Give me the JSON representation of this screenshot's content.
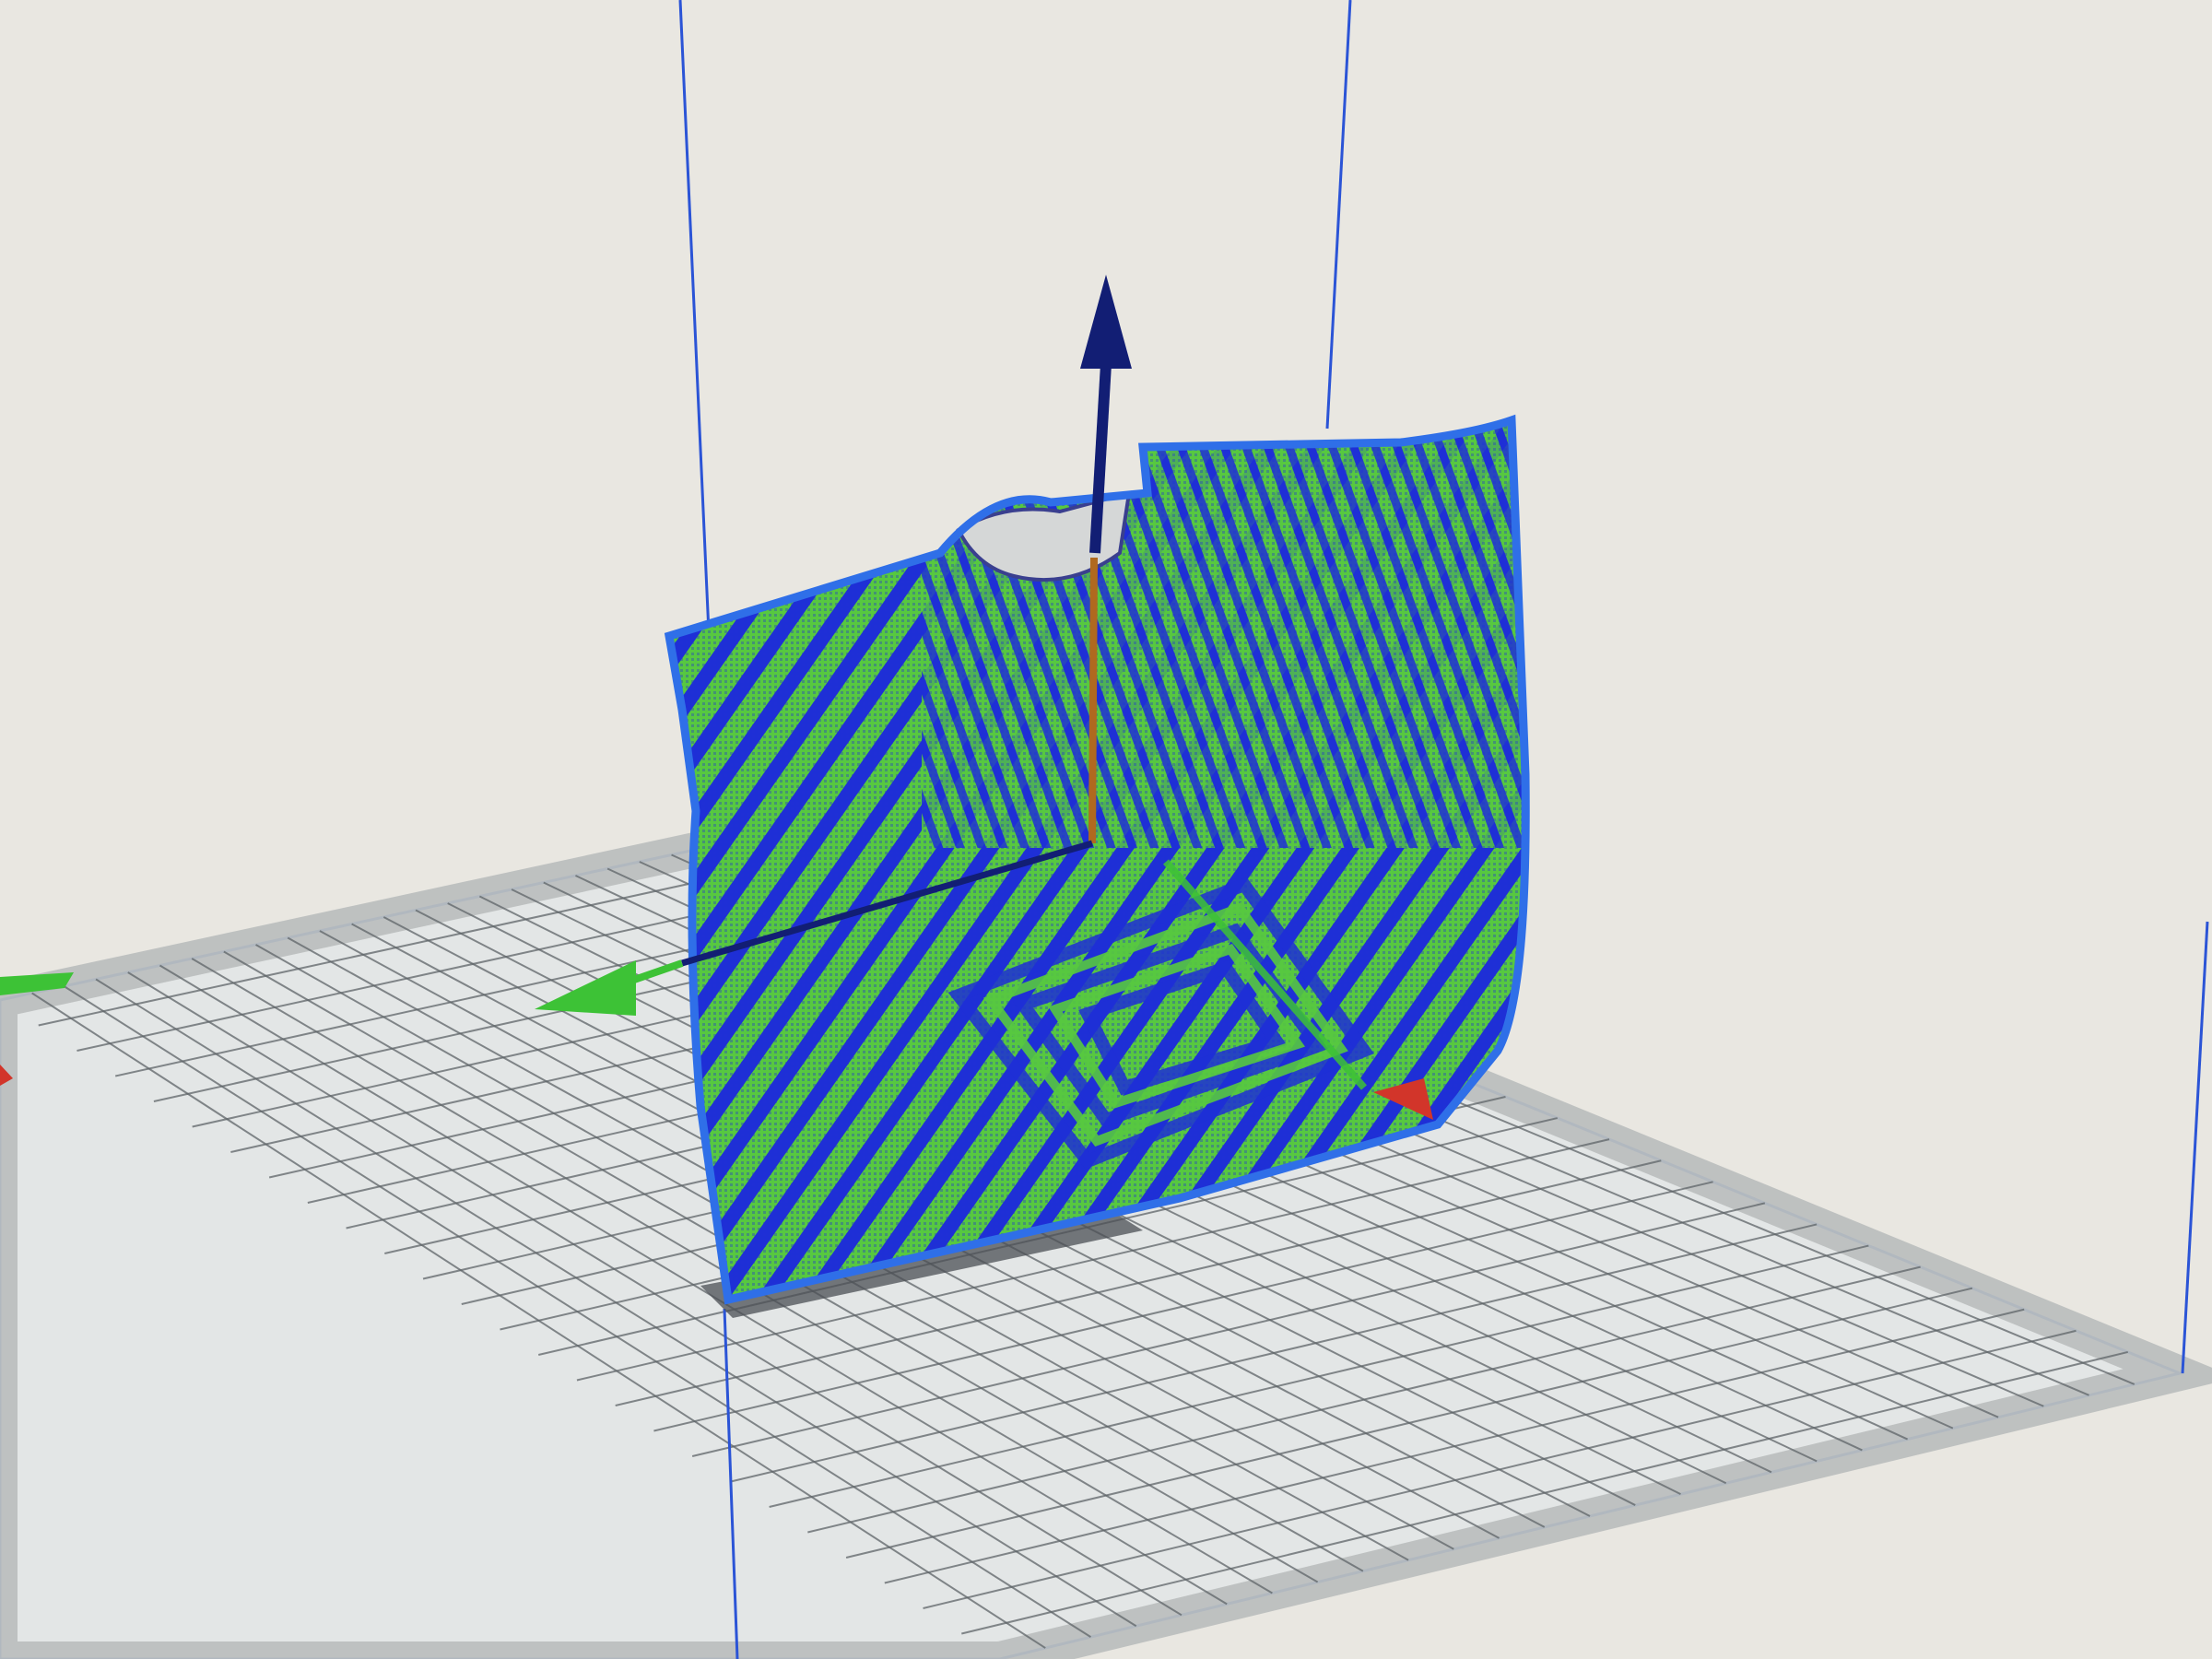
{
  "app": {
    "window_title": ""
  },
  "scene": {
    "view": "3d-slice-preview",
    "build_plate": {
      "grid": true
    },
    "model": {
      "label": "",
      "layer_colors": [
        "#57c840",
        "#1e2fd6"
      ]
    },
    "gizmo": {
      "axes": [
        "x",
        "y",
        "z"
      ]
    }
  },
  "colors": {
    "background": "#e9e7e1",
    "plate": "#e3e6e6",
    "plate_grid": "#5e6468",
    "plate_border": "#b9bcbc",
    "volume_outline": "#2b54d6",
    "model_green": "#57c840",
    "model_blue": "#1e2fd6",
    "model_outline": "#2f6fe8",
    "axis_x": "#d2352a",
    "axis_y": "#3dc236",
    "axis_z": "#121e74",
    "axis_z_stem": "#b0691f"
  }
}
